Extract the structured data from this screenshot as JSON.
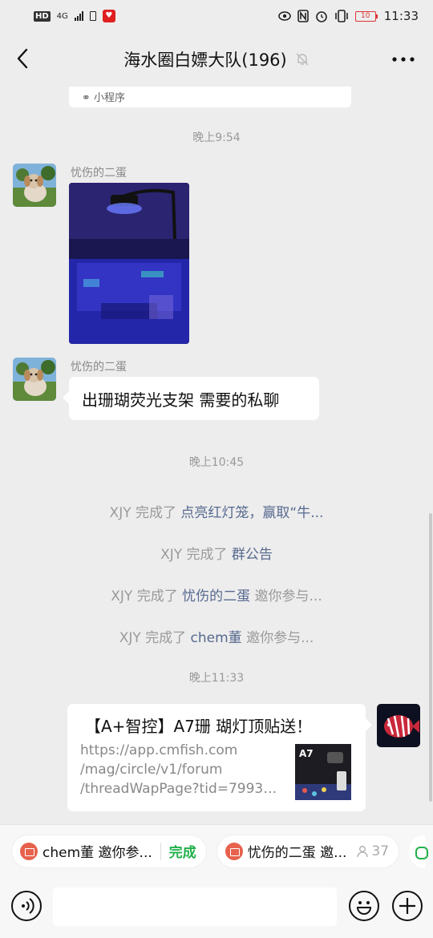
{
  "status_bar": {
    "hd": "HD",
    "network": "4G",
    "battery_level": "10",
    "time": "11:33"
  },
  "header": {
    "title": "海水圈白嫖大队(196)",
    "back_icon": "chevron-left-icon",
    "mute_icon": "bell-off-icon",
    "more_icon": "more-icon"
  },
  "messages": {
    "miniprogram_label": "小程序",
    "time1": "晚上9:54",
    "sender1": "忧伤的二蛋",
    "sender2": "忧伤的二蛋",
    "text2": "出珊瑚荧光支架 需要的私聊",
    "time2": "晚上10:45",
    "sys1": {
      "prefix": "XJY 完成了 ",
      "highlight": "点亮红灯笼，赢取“牛..."
    },
    "sys2": {
      "prefix": "XJY 完成了 ",
      "highlight": "群公告"
    },
    "sys3": {
      "prefix": "XJY 完成了 ",
      "highlight": "忧伤的二蛋",
      "suffix": " 邀你参与..."
    },
    "sys4": {
      "prefix": "XJY 完成了 ",
      "highlight": "chem董",
      "suffix": " 邀你参与..."
    },
    "time3": "晚上11:33",
    "link": {
      "title": "【A+智控】A7珊 瑚灯顶贴送！",
      "url_lines": [
        "https://app.cmfish.com",
        "/mag/circle/v1/forum",
        "/threadWapPage?tid=79930..."
      ],
      "thumb_label": "A7"
    }
  },
  "tasks": {
    "chip1_label": "chem董 邀你参...",
    "chip1_status": "完成",
    "chip2_label": "忧伤的二蛋 邀...",
    "chip2_count": "37"
  },
  "colors": {
    "background": "#ededed",
    "link_blue": "#56698f",
    "done_green": "#22b04b"
  }
}
